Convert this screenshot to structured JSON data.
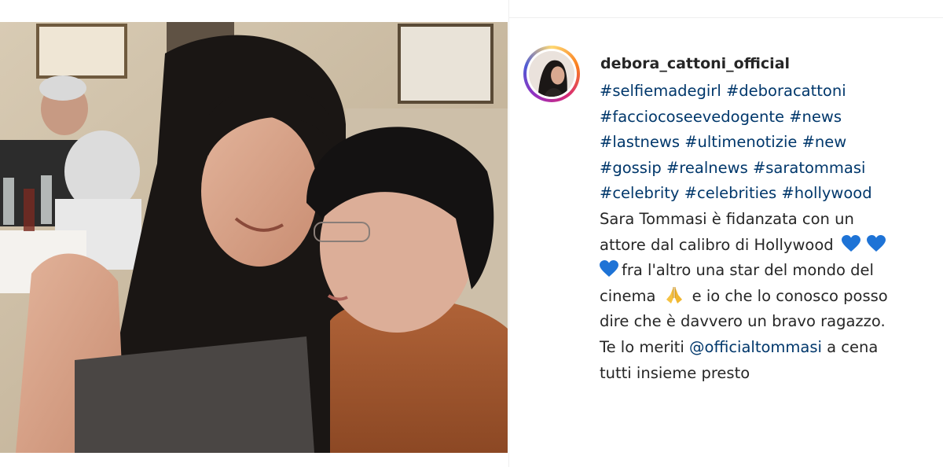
{
  "post": {
    "username": "debora_cattoni_official",
    "photo_icon": "photo-two-women-embrace",
    "avatar_icon": "profile-photo"
  },
  "caption": {
    "hashtags": [
      [
        "#selfiemadegirl",
        "#deboracattoni"
      ],
      [
        "#facciocoseevedogente",
        "#news"
      ],
      [
        "#lastnews",
        "#ultimenotizie",
        "#new"
      ],
      [
        "#gossip",
        "#realnews",
        "#saratommasi"
      ],
      [
        "#celebrity",
        "#celebrities",
        "#hollywood"
      ]
    ],
    "text_1": "Sara Tommasi è fidanzata con un",
    "text_2": "attore dal calibro di Hollywood",
    "text_3": "fra l'altro una star del mondo del",
    "text_4": "cinema",
    "text_4b": "e io che lo conosco posso",
    "text_5": "dire che è davvero un bravo ragazzo.",
    "text_6a": "Te lo meriti",
    "mention": "@officialtommasi",
    "text_6b": "a cena",
    "text_7": "tutti insieme presto",
    "emoji_heart": "blue-heart-icon",
    "emoji_pray": "folded-hands-icon"
  },
  "colors": {
    "link": "#00376b",
    "text": "#262626",
    "heart": "#1e73d6"
  }
}
